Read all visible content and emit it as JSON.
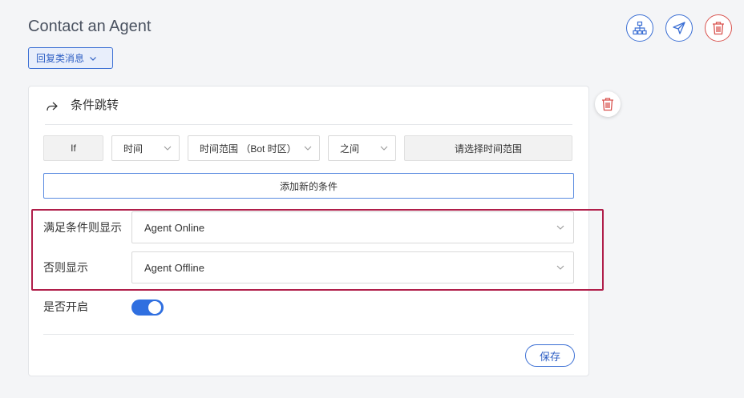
{
  "page": {
    "title": "Contact an Agent",
    "message_type": "回复类消息"
  },
  "top_actions": [
    {
      "name": "flow-diagram-icon"
    },
    {
      "name": "send-icon"
    },
    {
      "name": "trash-icon"
    }
  ],
  "card": {
    "title": "条件跳转",
    "condition": {
      "if_label": "If",
      "field": "时间",
      "scope": "时间范围 （Bot 时区）",
      "operator": "之间",
      "range_placeholder": "请选择时间范围"
    },
    "add_condition_label": "添加新的条件",
    "then_label": "满足条件则显示",
    "then_value": "Agent Online",
    "else_label": "否则显示",
    "else_value": "Agent Offline",
    "enabled_label": "是否开启",
    "enabled": true,
    "save_label": "保存"
  },
  "colors": {
    "accent": "#3b6fd4",
    "danger": "#d9534f",
    "highlight": "#b01e4a",
    "toggle_on": "#2f6fe0"
  }
}
